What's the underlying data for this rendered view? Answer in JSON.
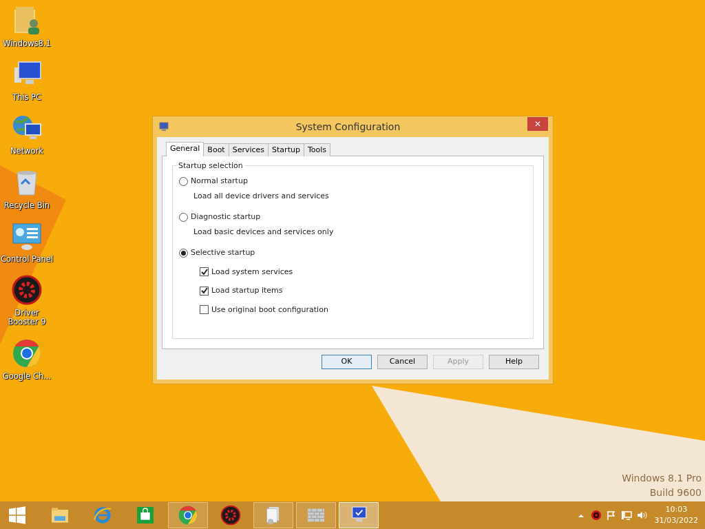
{
  "desktop_icons": [
    {
      "kind": "folder",
      "label": "Windows8.1"
    },
    {
      "kind": "pc",
      "label": "This PC"
    },
    {
      "kind": "network",
      "label": "Network"
    },
    {
      "kind": "bin",
      "label": "Recycle Bin"
    },
    {
      "kind": "panel",
      "label": "Control Panel"
    },
    {
      "kind": "booster",
      "label": "Driver Booster 9"
    },
    {
      "kind": "chrome",
      "label": "Google Ch..."
    }
  ],
  "window": {
    "title": "System Configuration",
    "close": "✕",
    "tabs": [
      {
        "label": "General",
        "selected": true
      },
      {
        "label": "Boot",
        "selected": false
      },
      {
        "label": "Services",
        "selected": false
      },
      {
        "label": "Startup",
        "selected": false
      },
      {
        "label": "Tools",
        "selected": false
      }
    ],
    "group_title": "Startup selection",
    "options": [
      {
        "label": "Normal startup",
        "description": "Load all device drivers and services",
        "selected": false
      },
      {
        "label": "Diagnostic startup",
        "description": "Load basic devices and services only",
        "selected": false
      },
      {
        "label": "Selective startup",
        "selected": true,
        "sub_options": [
          {
            "label": "Load system services",
            "checked": true
          },
          {
            "label": "Load startup items",
            "checked": true
          },
          {
            "label": "Use original boot configuration",
            "checked": false
          }
        ]
      }
    ],
    "buttons": [
      {
        "label": "OK",
        "disabled": false,
        "focused": true
      },
      {
        "label": "Cancel",
        "disabled": false,
        "focused": false
      },
      {
        "label": "Apply",
        "disabled": true,
        "focused": false
      },
      {
        "label": "Help",
        "disabled": false,
        "focused": false
      }
    ]
  },
  "os_watermark": [
    "Windows 8.1 Pro",
    "Build 9600"
  ],
  "taskbar": {
    "items": [
      {
        "kind": "start",
        "open": false,
        "selected": false
      },
      {
        "kind": "explorer",
        "open": false,
        "selected": false
      },
      {
        "kind": "ie",
        "open": false,
        "selected": false
      },
      {
        "kind": "store",
        "open": false,
        "selected": false
      },
      {
        "kind": "chrome",
        "open": true,
        "selected": false
      },
      {
        "kind": "booster",
        "open": false,
        "selected": false
      },
      {
        "kind": "setup",
        "open": true,
        "selected": false
      },
      {
        "kind": "wall",
        "open": true,
        "selected": false
      },
      {
        "kind": "msconfig",
        "open": true,
        "selected": true
      }
    ],
    "tray": [
      {
        "kind": "up"
      },
      {
        "kind": "booster"
      },
      {
        "kind": "flag"
      },
      {
        "kind": "network"
      },
      {
        "kind": "speaker"
      }
    ],
    "time": "10:03",
    "date": "31/03/2022"
  }
}
